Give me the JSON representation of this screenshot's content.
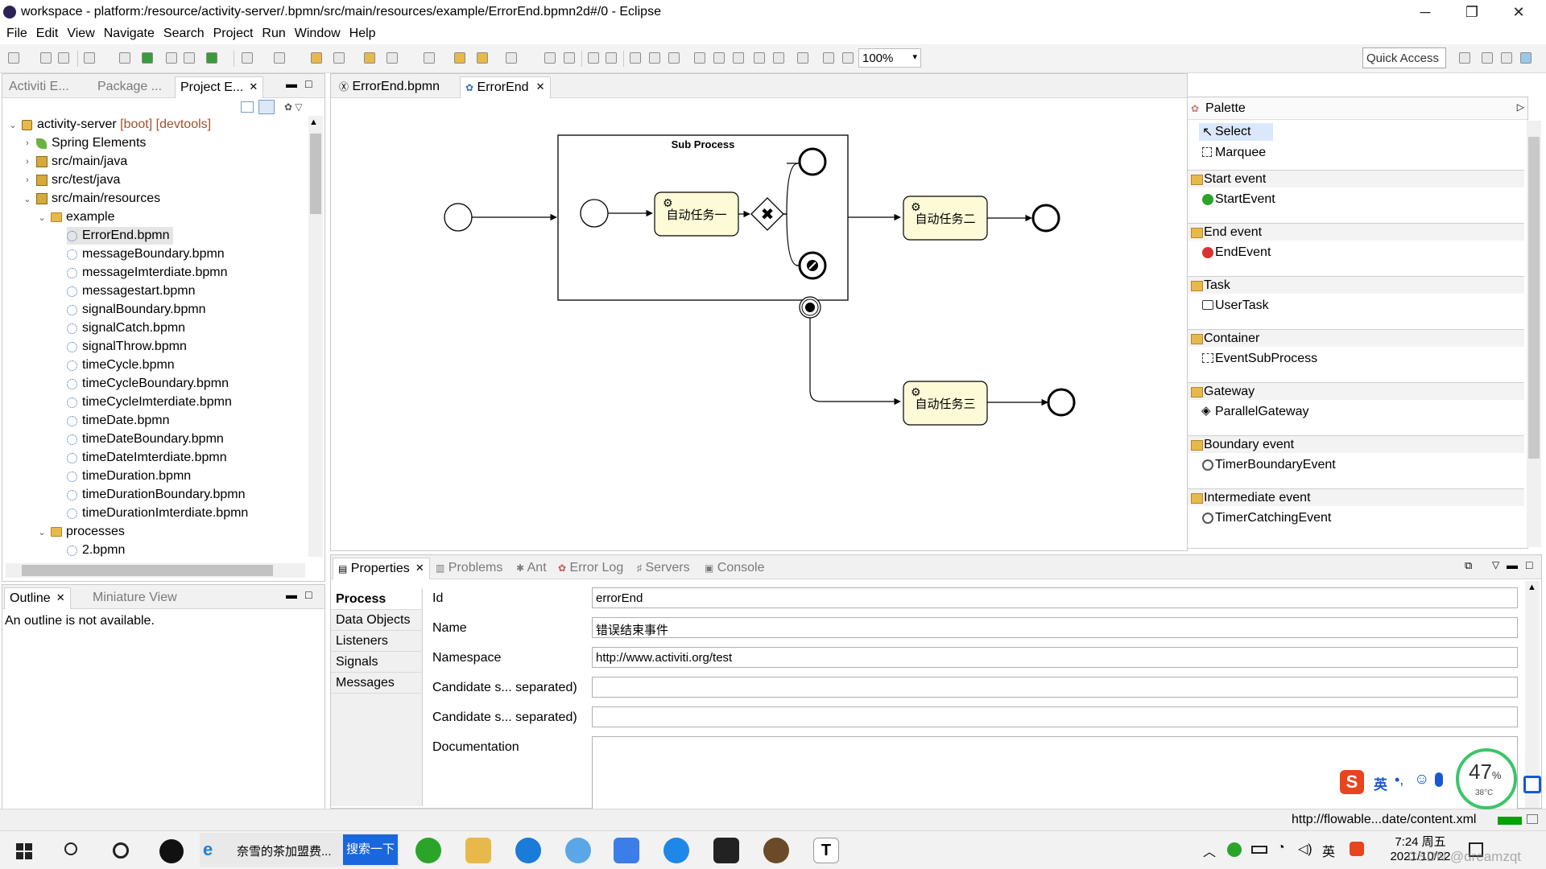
{
  "window": {
    "title": "workspace - platform:/resource/activity-server/.bpmn/src/main/resources/example/ErrorEnd.bpmn2d#/0 - Eclipse",
    "minimize": "─",
    "restore": "❐",
    "close": "✕"
  },
  "menu": [
    "File",
    "Edit",
    "View",
    "Navigate",
    "Search",
    "Project",
    "Run",
    "Window",
    "Help"
  ],
  "toolbar": {
    "zoom": "100%",
    "quick_access": "Quick Access"
  },
  "explorer": {
    "tabs": [
      "Activiti E...",
      "Package ...",
      "Project E..."
    ],
    "project": "activity-server",
    "project_tags": "[boot] [devtools]",
    "nodes": [
      "Spring Elements",
      "src/main/java",
      "src/test/java",
      "src/main/resources",
      "example"
    ],
    "files": [
      "ErrorEnd.bpmn",
      "messageBoundary.bpmn",
      "messageImterdiate.bpmn",
      "messagestart.bpmn",
      "signalBoundary.bpmn",
      "signalCatch.bpmn",
      "signalThrow.bpmn",
      "timeCycle.bpmn",
      "timeCycleBoundary.bpmn",
      "timeCycleImterdiate.bpmn",
      "timeDate.bpmn",
      "timeDateBoundary.bpmn",
      "timeDateImterdiate.bpmn",
      "timeDuration.bpmn",
      "timeDurationBoundary.bpmn",
      "timeDurationImterdiate.bpmn"
    ],
    "processes_folder": "processes",
    "process_file": "2.bpmn"
  },
  "outline": {
    "tabs": [
      "Outline",
      "Miniature View"
    ],
    "message": "An outline is not available."
  },
  "editor": {
    "tabs": [
      "ErrorEnd.bpmn",
      "ErrorEnd"
    ],
    "subprocess_label": "Sub Process",
    "task1": "自动任务一",
    "task2": "自动任务二",
    "task3": "自动任务三"
  },
  "palette": {
    "title": "Palette",
    "tools": [
      "Select",
      "Marquee"
    ],
    "groups": [
      {
        "name": "Start event",
        "item": "StartEvent"
      },
      {
        "name": "End event",
        "item": "EndEvent"
      },
      {
        "name": "Task",
        "item": "UserTask"
      },
      {
        "name": "Container",
        "item": "EventSubProcess"
      },
      {
        "name": "Gateway",
        "item": "ParallelGateway"
      },
      {
        "name": "Boundary event",
        "item": "TimerBoundaryEvent"
      },
      {
        "name": "Intermediate event",
        "item": "TimerCatchingEvent"
      }
    ]
  },
  "bottom": {
    "tabs": [
      "Properties",
      "Problems",
      "Ant",
      "Error Log",
      "Servers",
      "Console"
    ],
    "side_tabs": [
      "Process",
      "Data Objects",
      "Listeners",
      "Signals",
      "Messages"
    ],
    "fields": [
      {
        "label": "Id",
        "value": "errorEnd"
      },
      {
        "label": "Name",
        "value": "错误结束事件"
      },
      {
        "label": "Namespace",
        "value": "http://www.activiti.org/test"
      },
      {
        "label": "Candidate s... separated)",
        "value": ""
      },
      {
        "label": "Candidate s... separated)",
        "value": ""
      }
    ],
    "documentation_label": "Documentation"
  },
  "status": {
    "url": "http://flowable...date/content.xml"
  },
  "overlay": {
    "cpu": "47",
    "cpu_unit": "%",
    "temp": "38°C",
    "ime": "英"
  },
  "taskbar": {
    "search_text": "奈雪的茶加盟费...",
    "search_button": "搜索一下",
    "time": "7:24 周五",
    "date": "2021/10/22",
    "tray_ime": "英",
    "watermark": "CSDN @dreamzqt"
  }
}
